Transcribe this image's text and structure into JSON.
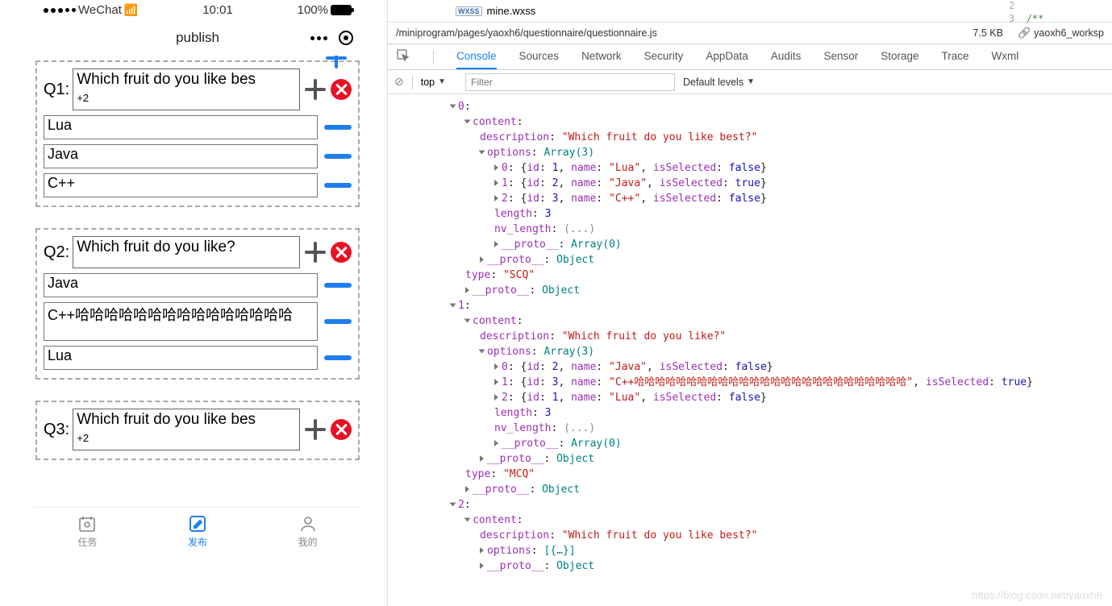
{
  "phone": {
    "carrier": "WeChat",
    "time": "10:01",
    "battery": "100%",
    "page_title": "publish",
    "questions": [
      {
        "label": "Q1:",
        "description": "Which fruit do you like best?",
        "input_overflow": "+2",
        "options": [
          "Lua",
          "Java",
          "C++"
        ],
        "show_float_plus": true
      },
      {
        "label": "Q2:",
        "description": "Which fruit do you like?",
        "options": [
          "Java",
          "C++哈哈哈哈哈哈哈哈哈哈哈哈哈哈哈哈哈哈哈哈哈哈哈哈哈哈",
          "Lua"
        ],
        "tall_option_index": 1
      },
      {
        "label": "Q3:",
        "description": "Which fruit do you like best?",
        "input_overflow": "+2"
      }
    ],
    "nav": [
      {
        "label": "任务",
        "icon": "calendar-gear-icon"
      },
      {
        "label": "发布",
        "icon": "edit-icon",
        "active": true
      },
      {
        "label": "我的",
        "icon": "user-icon"
      }
    ]
  },
  "devtools": {
    "file_tab": "mine.wxss",
    "file_tab_badge": "WXSS",
    "line_nums": [
      "2",
      "3"
    ],
    "comment_start": "/**",
    "path": "/miniprogram/pages/yaoxh6/questionnaire/questionnaire.js",
    "file_size": "7.5 KB",
    "workspace": "yaoxh6_worksp",
    "tabs": [
      "Console",
      "Sources",
      "Network",
      "Security",
      "AppData",
      "Audits",
      "Sensor",
      "Storage",
      "Trace",
      "Wxml"
    ],
    "active_tab": "Console",
    "context": "top",
    "filter_placeholder": "Filter",
    "levels_label": "Default levels",
    "console_objects": [
      {
        "idx": "0",
        "description": "Which fruit do you like best?",
        "options_label": "Array(3)",
        "options": [
          {
            "idx": "0",
            "id": "1",
            "name": "Lua",
            "isSelected": "false"
          },
          {
            "idx": "1",
            "id": "2",
            "name": "Java",
            "isSelected": "true"
          },
          {
            "idx": "2",
            "id": "3",
            "name": "C++",
            "isSelected": "false"
          }
        ],
        "length": "3",
        "nv_length": "(...)",
        "proto_arr": "Array(0)",
        "proto_obj": "Object",
        "type": "SCQ",
        "outer_proto": "Object"
      },
      {
        "idx": "1",
        "description": "Which fruit do you like?",
        "options_label": "Array(3)",
        "options": [
          {
            "idx": "0",
            "id": "2",
            "name": "Java",
            "isSelected": "false"
          },
          {
            "idx": "1",
            "id": "3",
            "name": "C++哈哈哈哈哈哈哈哈哈哈哈哈哈哈哈哈哈哈哈哈哈哈哈哈哈哈",
            "isSelected": "true"
          },
          {
            "idx": "2",
            "id": "1",
            "name": "Lua",
            "isSelected": "false"
          }
        ],
        "length": "3",
        "nv_length": "(...)",
        "proto_arr": "Array(0)",
        "proto_obj": "Object",
        "type": "MCQ",
        "outer_proto": "Object"
      }
    ],
    "partial_object": {
      "idx": "2",
      "description": "Which fruit do you like best?",
      "options_label": "[{…}]",
      "proto_obj": "Object"
    }
  },
  "watermark": "https://blog.csdn.net/yaoxh6"
}
